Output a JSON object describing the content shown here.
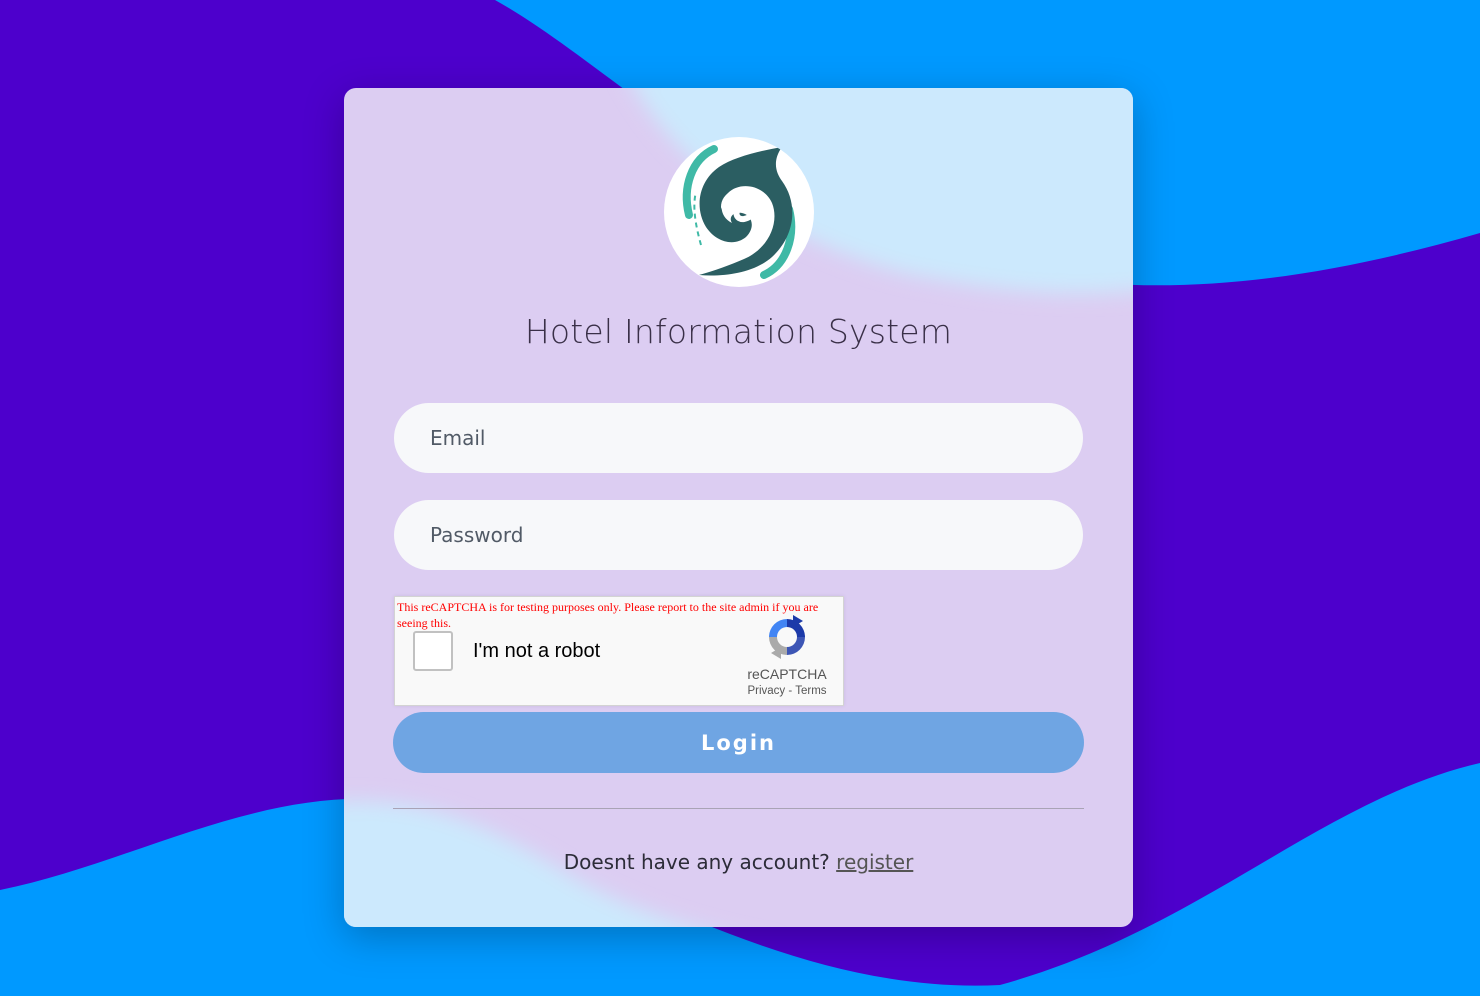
{
  "colors": {
    "background_wave_dark": "#4d00cc",
    "background_wave_light": "#0099ff",
    "card_purple": "#dccdf2",
    "card_blue": "#cce9fd",
    "login_button": "#6fa5e3",
    "logo_dark_teal": "#2b5e62",
    "logo_light_teal": "#3fb9a6"
  },
  "header": {
    "logo_icon": "hotel-logo-icon",
    "title": "Hotel Information System"
  },
  "form": {
    "email_placeholder": "Email",
    "password_placeholder": "Password",
    "login_label": "Login"
  },
  "captcha": {
    "warning": "This reCAPTCHA is for testing purposes only. Please report to the site admin if you are seeing this.",
    "checkbox_label": "I'm not a robot",
    "brand": "reCAPTCHA",
    "privacy_label": "Privacy",
    "separator": "-",
    "terms_label": "Terms"
  },
  "footer": {
    "prompt": "Doesnt have any account?",
    "register_label": "register"
  }
}
